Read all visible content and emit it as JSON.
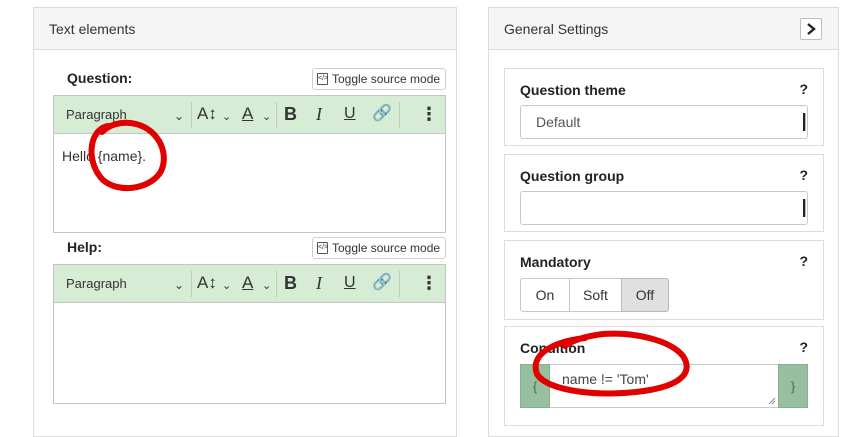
{
  "text_elements": {
    "panel_title": "Text elements",
    "question_label": "Question:",
    "help_label": "Help:",
    "toggle_source_label": "Toggle source mode",
    "paragraph_label": "Paragraph",
    "question_text": "Hello {name}.",
    "help_text": ""
  },
  "general_settings": {
    "panel_title": "General Settings",
    "question_theme": {
      "label": "Question theme",
      "help": "?",
      "value": "Default"
    },
    "question_group": {
      "label": "Question group",
      "help": "?",
      "value": ""
    },
    "mandatory": {
      "label": "Mandatory",
      "help": "?",
      "options": [
        "On",
        "Soft",
        "Off"
      ],
      "selected": "Off"
    },
    "condition": {
      "label": "Condition",
      "help": "?",
      "open_brace": "{",
      "close_brace": "}",
      "value": "name != 'Tom'"
    }
  },
  "colors": {
    "toolbar_bg": "#d7ecd4",
    "brace_bg": "#98bfa0",
    "annotation": "#e00000"
  }
}
